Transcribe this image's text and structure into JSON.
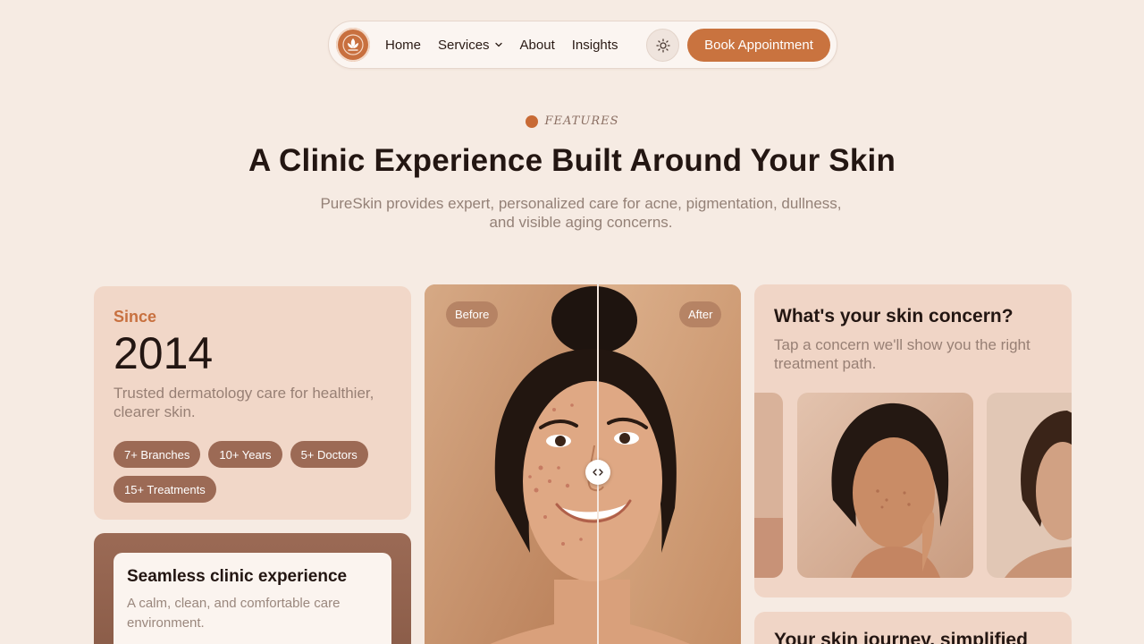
{
  "nav": {
    "links": [
      "Home",
      "Services",
      "About",
      "Insights"
    ],
    "cta": "Book Appointment"
  },
  "hero": {
    "eyebrow": "FEATURES",
    "title": "A Clinic Experience Built Around Your Skin",
    "subtitle_line1": "PureSkin provides expert, personalized care for acne, pigmentation, dullness,",
    "subtitle_line2": "and visible aging concerns."
  },
  "since": {
    "label": "Since",
    "year": "2014",
    "desc": "Trusted dermatology care for healthier, clearer skin.",
    "chips": [
      "7+ Branches",
      "10+ Years",
      "5+ Doctors",
      "15+ Treatments"
    ]
  },
  "experience": {
    "title": "Seamless clinic experience",
    "desc": "A calm, clean, and comfortable care environment."
  },
  "compare": {
    "before": "Before",
    "after": "After",
    "slider_position": 0.54
  },
  "concern": {
    "title": "What's your skin concern?",
    "subtitle": "Tap a concern we'll show you the right treatment path."
  },
  "journey": {
    "title": "Your skin journey, simplified"
  },
  "colors": {
    "accent": "#c9733f",
    "background": "#f6ebe3",
    "card": "#f1d7c8",
    "chip": "#9c6a55"
  },
  "icons": [
    "leaf-logo-icon",
    "chevron-down-icon",
    "sun-icon",
    "compare-arrows-icon"
  ]
}
